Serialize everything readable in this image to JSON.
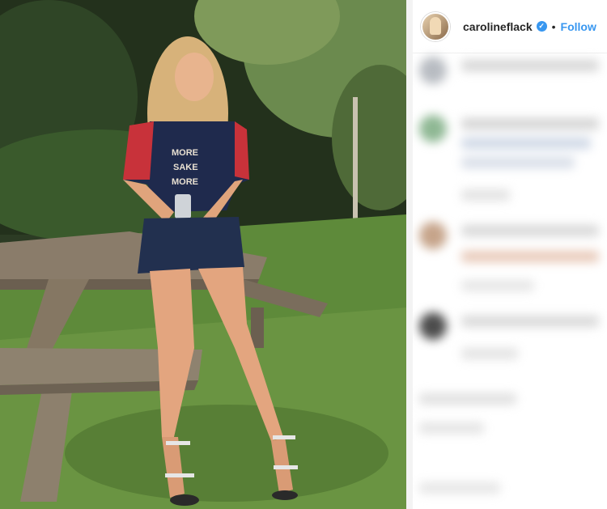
{
  "post": {
    "username": "carolineflack",
    "separator": "•",
    "follow_label": "Follow",
    "verified": true
  },
  "colors": {
    "accent": "#3897f0",
    "username": "#262626",
    "blur_gray": "#d9d9d9"
  },
  "icons": [
    "avatar",
    "verified-badge-icon"
  ]
}
